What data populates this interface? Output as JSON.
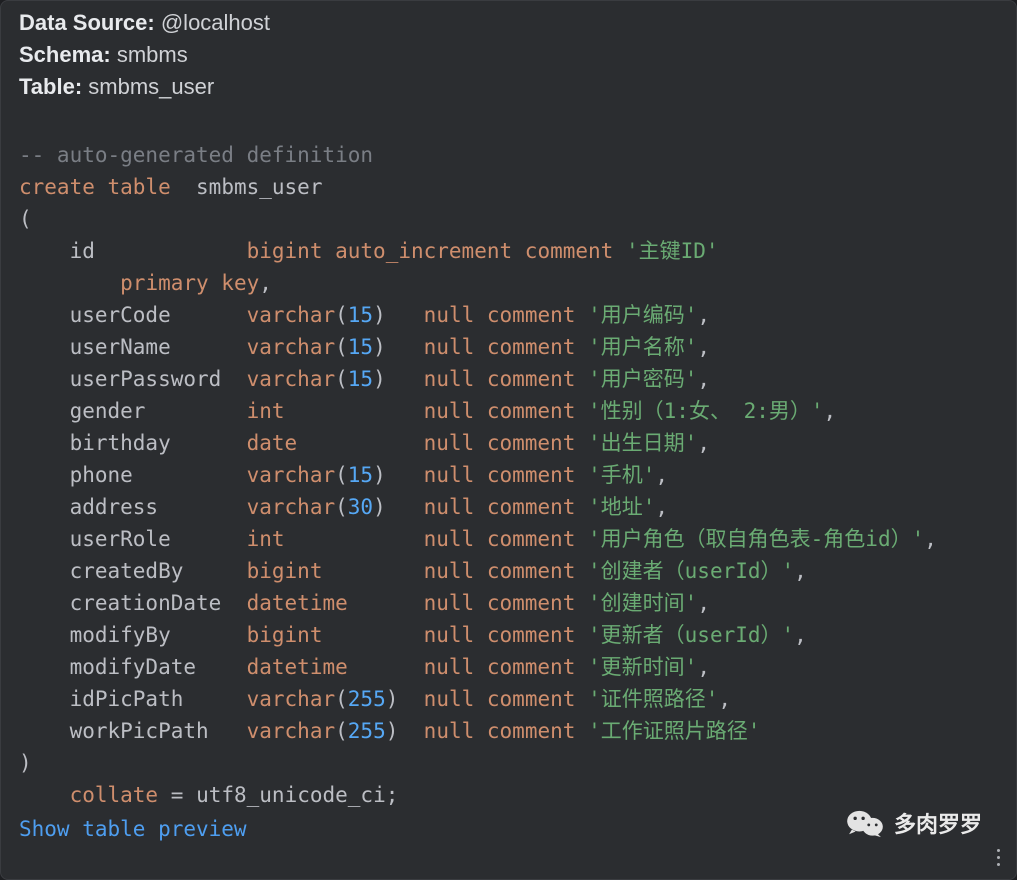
{
  "meta": {
    "data_source_label": "Data Source:",
    "data_source_value": "@localhost",
    "schema_label": "Schema:",
    "schema_value": "smbms",
    "table_label": "Table:",
    "table_value": "smbms_user"
  },
  "sql": {
    "comment": "-- auto-generated definition",
    "create_kw": "create",
    "table_kw": "table",
    "table_name": "smbms_user",
    "open_paren": "(",
    "primary_key": "primary key",
    "columns": [
      {
        "name": "id",
        "type": "bigint",
        "len": "",
        "extra": "auto_increment",
        "null": "",
        "cmt_kw": "comment",
        "cmt": "'主键ID'"
      },
      {
        "name": "userCode",
        "type": "varchar",
        "len": "15",
        "extra": "",
        "null": "null",
        "cmt_kw": "comment",
        "cmt": "'用户编码'"
      },
      {
        "name": "userName",
        "type": "varchar",
        "len": "15",
        "extra": "",
        "null": "null",
        "cmt_kw": "comment",
        "cmt": "'用户名称'"
      },
      {
        "name": "userPassword",
        "type": "varchar",
        "len": "15",
        "extra": "",
        "null": "null",
        "cmt_kw": "comment",
        "cmt": "'用户密码'"
      },
      {
        "name": "gender",
        "type": "int",
        "len": "",
        "extra": "",
        "null": "null",
        "cmt_kw": "comment",
        "cmt": "'性别（1:女、 2:男）'"
      },
      {
        "name": "birthday",
        "type": "date",
        "len": "",
        "extra": "",
        "null": "null",
        "cmt_kw": "comment",
        "cmt": "'出生日期'"
      },
      {
        "name": "phone",
        "type": "varchar",
        "len": "15",
        "extra": "",
        "null": "null",
        "cmt_kw": "comment",
        "cmt": "'手机'"
      },
      {
        "name": "address",
        "type": "varchar",
        "len": "30",
        "extra": "",
        "null": "null",
        "cmt_kw": "comment",
        "cmt": "'地址'"
      },
      {
        "name": "userRole",
        "type": "int",
        "len": "",
        "extra": "",
        "null": "null",
        "cmt_kw": "comment",
        "cmt": "'用户角色（取自角色表-角色id）'"
      },
      {
        "name": "createdBy",
        "type": "bigint",
        "len": "",
        "extra": "",
        "null": "null",
        "cmt_kw": "comment",
        "cmt": "'创建者（userId）'"
      },
      {
        "name": "creationDate",
        "type": "datetime",
        "len": "",
        "extra": "",
        "null": "null",
        "cmt_kw": "comment",
        "cmt": "'创建时间'"
      },
      {
        "name": "modifyBy",
        "type": "bigint",
        "len": "",
        "extra": "",
        "null": "null",
        "cmt_kw": "comment",
        "cmt": "'更新者（userId）'"
      },
      {
        "name": "modifyDate",
        "type": "datetime",
        "len": "",
        "extra": "",
        "null": "null",
        "cmt_kw": "comment",
        "cmt": "'更新时间'"
      },
      {
        "name": "idPicPath",
        "type": "varchar",
        "len": "255",
        "extra": "",
        "null": "null",
        "cmt_kw": "comment",
        "cmt": "'证件照路径'"
      },
      {
        "name": "workPicPath",
        "type": "varchar",
        "len": "255",
        "extra": "",
        "null": "null",
        "cmt_kw": "comment",
        "cmt": "'工作证照片路径'"
      }
    ],
    "close_paren": ")",
    "collate_line": {
      "collate_kw": "collate",
      "collate_val": "utf8_unicode_ci"
    }
  },
  "link": {
    "show_preview": "Show table preview"
  },
  "watermark": {
    "text": "多肉罗罗"
  },
  "layout": {
    "name_col_w": 13,
    "type_col_w": 13,
    "null_col_w": 5
  }
}
